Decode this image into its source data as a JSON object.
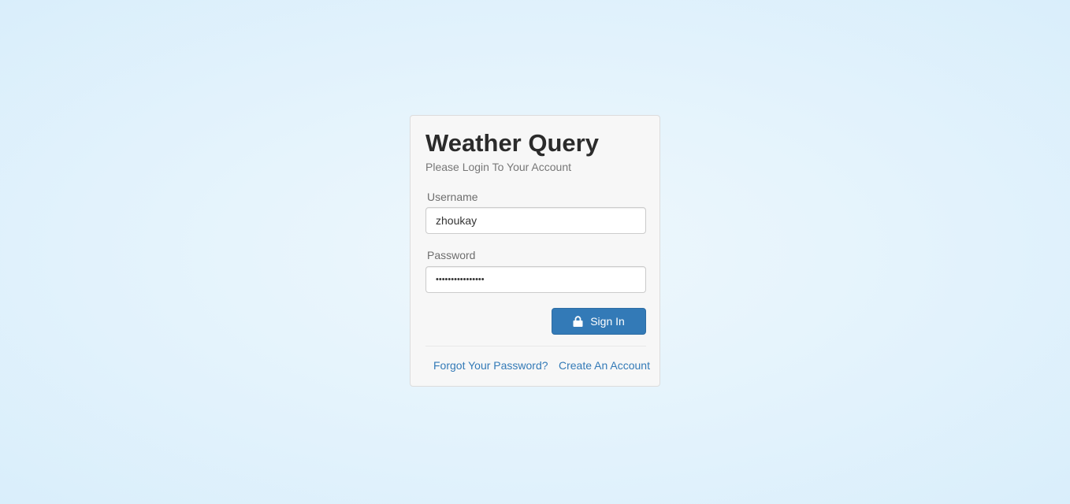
{
  "login": {
    "title": "Weather Query",
    "subtitle": "Please Login To Your Account",
    "username_label": "Username",
    "username_value": "zhoukay",
    "password_label": "Password",
    "password_value": "••••••••••••••••",
    "sign_in_label": "Sign In",
    "sign_in_icon": "lock-icon",
    "forgot_link": "Forgot Your Password?",
    "create_link": "Create An Account"
  },
  "colors": {
    "primary": "#337ab7",
    "card_background": "#f7f7f7",
    "page_background": "#e6f4fc"
  }
}
